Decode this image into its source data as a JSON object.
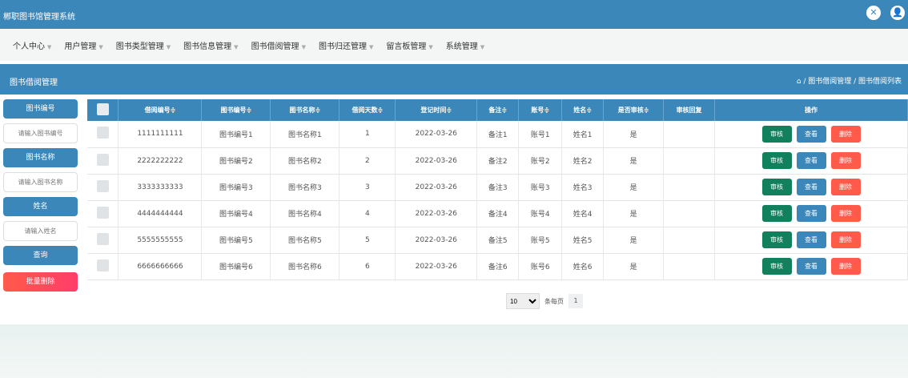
{
  "app": {
    "title": "郴职图书馆管理系统"
  },
  "nav": [
    "个人中心",
    "用户管理",
    "图书类型管理",
    "图书信息管理",
    "图书借阅管理",
    "图书归还管理",
    "留言板管理",
    "系统管理"
  ],
  "page": {
    "title": "图书借阅管理",
    "breadcrumb": "/ 图书借阅管理 / 图书借阅列表"
  },
  "search": {
    "label1": "图书编号",
    "ph1": "请输入图书编号",
    "label2": "图书名称",
    "ph2": "请输入图书名称",
    "label3": "姓名",
    "ph3": "请输入姓名",
    "query": "查询",
    "batch_delete": "批量删除"
  },
  "table": {
    "headers": [
      "借阅编号≑",
      "图书编号≑",
      "图书名称≑",
      "借阅天数≑",
      "登记时间≑",
      "备注≑",
      "账号≑",
      "姓名≑",
      "是否审核≑",
      "审核回复",
      "操作"
    ],
    "rows": [
      [
        "1111111111",
        "图书编号1",
        "图书名称1",
        "1",
        "2022-03-26",
        "备注1",
        "账号1",
        "姓名1",
        "是",
        ""
      ],
      [
        "2222222222",
        "图书编号2",
        "图书名称2",
        "2",
        "2022-03-26",
        "备注2",
        "账号2",
        "姓名2",
        "是",
        ""
      ],
      [
        "3333333333",
        "图书编号3",
        "图书名称3",
        "3",
        "2022-03-26",
        "备注3",
        "账号3",
        "姓名3",
        "是",
        ""
      ],
      [
        "4444444444",
        "图书编号4",
        "图书名称4",
        "4",
        "2022-03-26",
        "备注4",
        "账号4",
        "姓名4",
        "是",
        ""
      ],
      [
        "5555555555",
        "图书编号5",
        "图书名称5",
        "5",
        "2022-03-26",
        "备注5",
        "账号5",
        "姓名5",
        "是",
        ""
      ],
      [
        "6666666666",
        "图书编号6",
        "图书名称6",
        "6",
        "2022-03-26",
        "备注6",
        "账号6",
        "姓名6",
        "是",
        ""
      ]
    ],
    "actions": {
      "review": "审核",
      "view": "查看",
      "delete": "删除"
    }
  },
  "pagination": {
    "page_size": "10",
    "per_page_label": "条每页",
    "current": "1"
  },
  "colors": {
    "primary": "#3c87ba",
    "review": "#12805c",
    "delete": "#ff5a4a"
  }
}
